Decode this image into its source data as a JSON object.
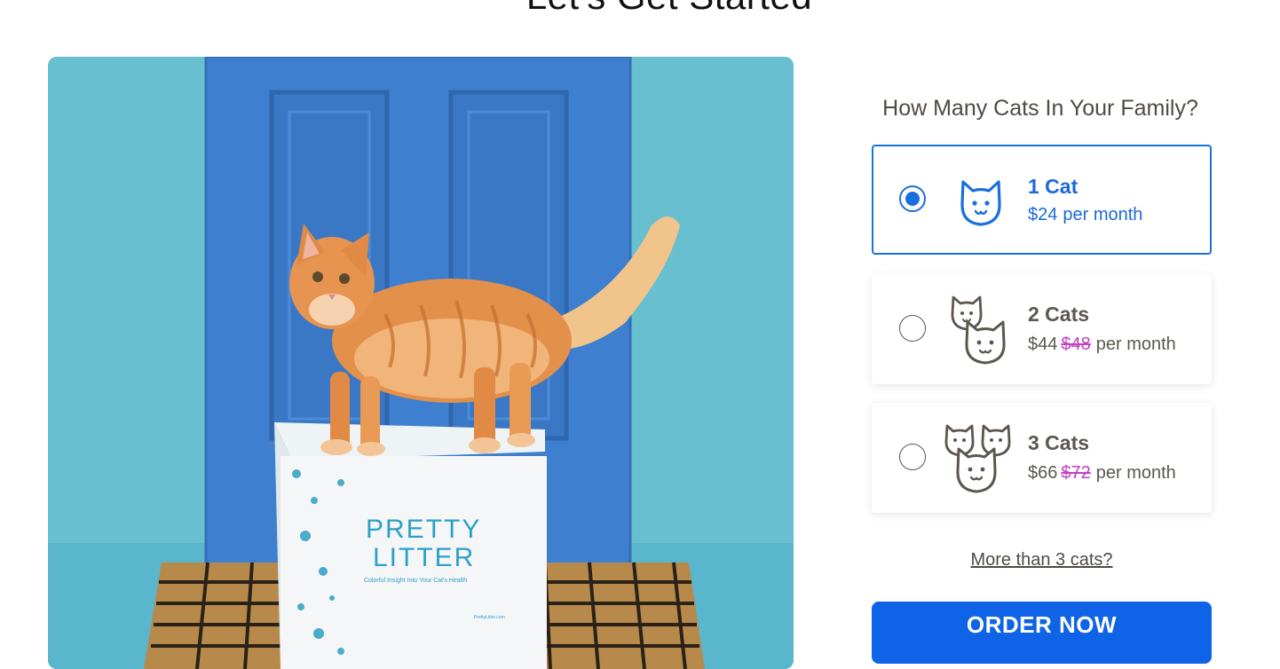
{
  "page": {
    "title": "Let's Get Started"
  },
  "hero": {
    "box_brand_line1": "PRETTY",
    "box_brand_line2": "LITTER",
    "box_tagline": "Colorful Insight Into Your Cat's Health",
    "box_url": "PrettyLitter.com"
  },
  "selector": {
    "question": "How Many Cats In Your Family?",
    "options": [
      {
        "title": "1 Cat",
        "price": "$24",
        "original_price": "",
        "period": "per month",
        "selected": true,
        "icon": "one-cat-icon"
      },
      {
        "title": "2 Cats",
        "price": "$44",
        "original_price": "$48",
        "period": "per month",
        "selected": false,
        "icon": "two-cats-icon"
      },
      {
        "title": "3 Cats",
        "price": "$66",
        "original_price": "$72",
        "period": "per month",
        "selected": false,
        "icon": "three-cats-icon"
      }
    ],
    "more_link": "More than 3 cats?",
    "order_button": "ORDER NOW"
  },
  "colors": {
    "accent": "#1a6fe0",
    "button": "#0f63e6",
    "strike": "#c13fc5",
    "text": "#4f4a45"
  }
}
